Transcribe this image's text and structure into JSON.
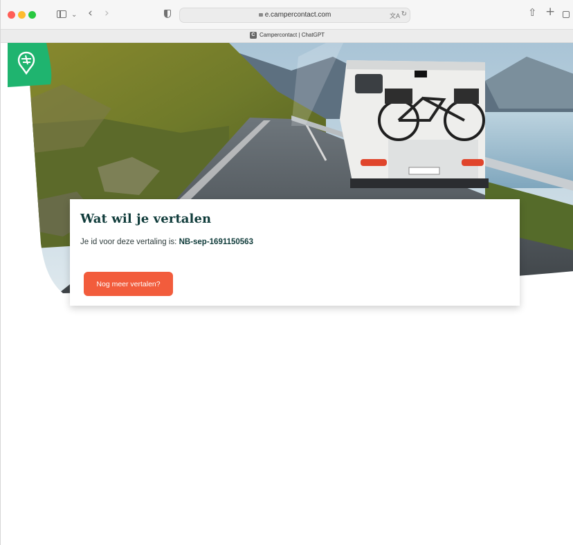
{
  "browser": {
    "url": "e.campercontact.com",
    "tab_title": "Campercontact | ChatGPT",
    "favicon_letter": "C"
  },
  "icons": {
    "sidebar": "sidebar-icon",
    "back": "chevron-left-icon",
    "forward": "chevron-right-icon",
    "privacy": "shield-icon",
    "translate": "translate-icon",
    "reload": "reload-icon",
    "share": "share-icon",
    "new_tab": "plus-icon",
    "tabs": "tab-overview-icon",
    "logo": "campercontact-logo"
  },
  "colors": {
    "brand_green": "#1fb46f",
    "title_teal": "#0f3b3a",
    "cta_orange": "#f25c3c"
  },
  "card": {
    "title": "Wat wil je vertalen",
    "id_label": "Je id voor deze vertaling is:",
    "id_value": "NB-sep-1691150563",
    "cta_label": "Nog meer vertalen?"
  }
}
